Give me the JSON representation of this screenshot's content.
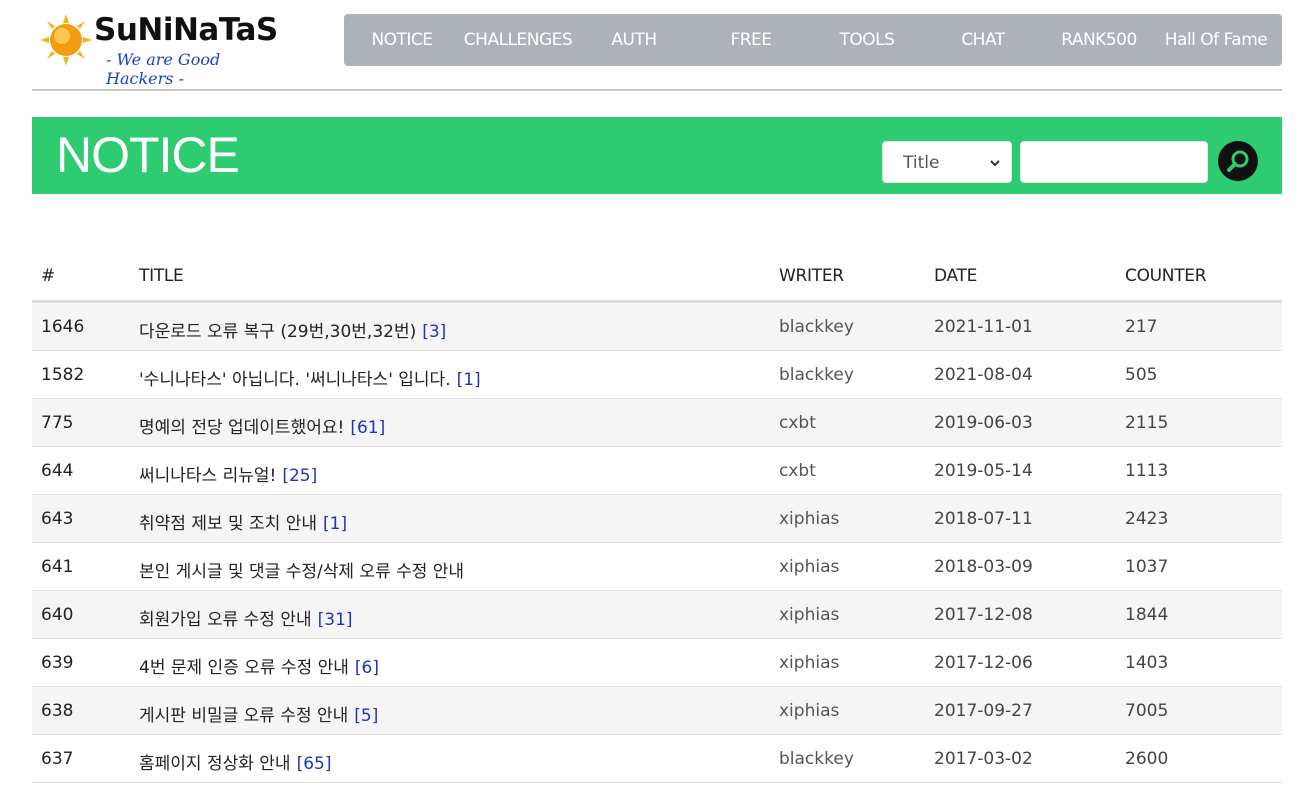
{
  "logo": {
    "title": "SuNiNaTaS",
    "subtitle": "- We are Good Hackers -"
  },
  "nav": {
    "items": [
      {
        "label": "NOTICE"
      },
      {
        "label": "CHALLENGES"
      },
      {
        "label": "AUTH"
      },
      {
        "label": "FREE"
      },
      {
        "label": "TOOLS"
      },
      {
        "label": "CHAT"
      },
      {
        "label": "RANK500"
      },
      {
        "label": "Hall Of Fame"
      }
    ]
  },
  "banner": {
    "title": "NOTICE",
    "search_select_value": "Title",
    "search_input_value": ""
  },
  "table": {
    "headers": {
      "num": "#",
      "title": "TITLE",
      "writer": "WRITER",
      "date": "DATE",
      "counter": "COUNTER"
    },
    "rows": [
      {
        "num": "1646",
        "title": "다운로드 오류 복구 (29번,30번,32번)",
        "comments": "[3]",
        "writer": "blackkey",
        "date": "2021-11-01",
        "counter": "217"
      },
      {
        "num": "1582",
        "title": "'수니나타스' 아닙니다. '써니나타스' 입니다.",
        "comments": "[1]",
        "writer": "blackkey",
        "date": "2021-08-04",
        "counter": "505"
      },
      {
        "num": "775",
        "title": "명예의 전당 업데이트했어요!",
        "comments": "[61]",
        "writer": "cxbt",
        "date": "2019-06-03",
        "counter": "2115"
      },
      {
        "num": "644",
        "title": "써니나타스 리뉴얼!",
        "comments": "[25]",
        "writer": "cxbt",
        "date": "2019-05-14",
        "counter": "1113"
      },
      {
        "num": "643",
        "title": "취약점 제보 및 조치 안내",
        "comments": "[1]",
        "writer": "xiphias",
        "date": "2018-07-11",
        "counter": "2423"
      },
      {
        "num": "641",
        "title": "본인 게시글 및 댓글 수정/삭제 오류 수정 안내",
        "comments": "",
        "writer": "xiphias",
        "date": "2018-03-09",
        "counter": "1037"
      },
      {
        "num": "640",
        "title": "회원가입 오류 수정 안내",
        "comments": "[31]",
        "writer": "xiphias",
        "date": "2017-12-08",
        "counter": "1844"
      },
      {
        "num": "639",
        "title": "4번 문제 인증 오류 수정 안내",
        "comments": "[6]",
        "writer": "xiphias",
        "date": "2017-12-06",
        "counter": "1403"
      },
      {
        "num": "638",
        "title": "게시판 비밀글 오류 수정 안내",
        "comments": "[5]",
        "writer": "xiphias",
        "date": "2017-09-27",
        "counter": "7005"
      },
      {
        "num": "637",
        "title": "홈페이지 정상화 안내",
        "comments": "[65]",
        "writer": "blackkey",
        "date": "2017-03-02",
        "counter": "2600"
      }
    ]
  }
}
